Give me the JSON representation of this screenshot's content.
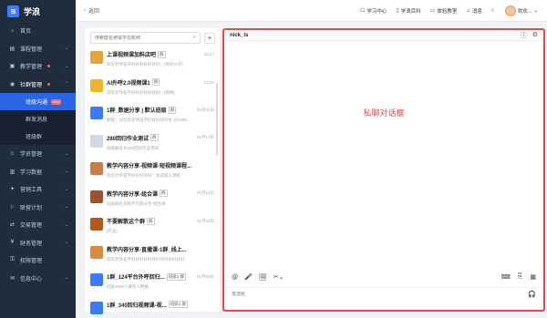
{
  "app": {
    "logo_mark": "≋",
    "name": "学浪"
  },
  "sidebar": {
    "items": [
      {
        "label": "首页",
        "icon": "⌂"
      },
      {
        "label": "课程管理",
        "icon": "▤",
        "arrow": "⌄"
      },
      {
        "label": "教学管理",
        "icon": "▣",
        "arrow": "⌄",
        "dot": true
      },
      {
        "label": "社群管理",
        "icon": "◉",
        "arrow": "⌃",
        "dot": true,
        "open": true
      }
    ],
    "sub_items": [
      {
        "label": "班级沟通",
        "badge": "new",
        "active": true
      },
      {
        "label": "群发消息"
      },
      {
        "label": "班级群"
      }
    ],
    "items_after": [
      {
        "label": "学员管理",
        "icon": "☺",
        "arrow": "⌄"
      },
      {
        "label": "学习数据",
        "icon": "▥",
        "arrow": "⌄"
      },
      {
        "label": "营销工具",
        "icon": "✦",
        "arrow": "⌄"
      },
      {
        "label": "联营计划",
        "icon": "⚐",
        "arrow": "⌄"
      },
      {
        "label": "交易管理",
        "icon": "⇄",
        "arrow": "⌄"
      },
      {
        "label": "财务管理",
        "icon": "¥",
        "arrow": "⌄"
      },
      {
        "label": "权限管理",
        "icon": "⚿"
      },
      {
        "label": "信息中心",
        "icon": "✉",
        "arrow": "⌄"
      }
    ]
  },
  "header": {
    "back_icon": "‹",
    "back_label": "返回",
    "links": [
      {
        "icon": "☖",
        "label": "学习中心"
      },
      {
        "icon": "▯",
        "label": "学浪百科"
      },
      {
        "icon": "▭",
        "label": "体验教室"
      },
      {
        "icon": "♫",
        "label": "消息"
      }
    ],
    "theme_icon": "☾",
    "username": "欢欢...",
    "user_arrow": "⌄"
  },
  "list": {
    "search_placeholder": "搜索群名称或学员昵称",
    "search_icon": "⌕",
    "add_icon": "+",
    "conversations": [
      {
        "title": "上课视频课加料店吧",
        "tag": "群",
        "time": "16:17",
        "preview": "欢欢老师名字好好好好好好好：[体验分享]",
        "color": "#e8a33a"
      },
      {
        "title": "AI外呼2.0视频课1",
        "tag": "群",
        "time": "14:20",
        "preview": "欢欢老师名字好好好好好好好：[视频]",
        "color": "#f0b429"
      },
      {
        "title": "1群_数据分享 | 默认班级",
        "tag": "群",
        "time": "01月30日",
        "preview": "群管：@欢欢老师名字好好好好好好 @4589...",
        "color": "#3b7bff"
      },
      {
        "title": "280回归作业测试",
        "tag": "群",
        "time": "01月17日",
        "preview": "班级群名为280回归作业测试",
        "color": "#cfd8e3"
      },
      {
        "title": "教学内容分享-视频课-短视频课程...",
        "tag": "",
        "time": "",
        "preview": "欢欢老师名字好好好好好：欢迎加入课程",
        "color": "#c97b4a"
      },
      {
        "title": "教学内容分享-组合课",
        "tag": "群",
        "time": "01月16日",
        "preview": "班级群名为教学内容分享-组合课",
        "color": "#a0522d"
      },
      {
        "title": "不要解散这个群",
        "tag": "群",
        "time": "01月10日",
        "preview": "[作业]",
        "color": "#b8561f"
      },
      {
        "title": "教学内容分享-直播课-1群_线上...",
        "tag": "",
        "time": "",
        "preview": "欢欢老师名字好好好好好好好好好好好好好",
        "color": "#d98c3a"
      },
      {
        "title": "1群_124平台外呼回归...",
        "tag": "班级2 群",
        "time": "01月09日",
        "preview": "班级4589人群新人数据",
        "color": "#3b7bff"
      },
      {
        "title": "1群_340回归视频课-视...",
        "tag": "班级2 群",
        "time": "",
        "preview": "",
        "color": "#3b7bff"
      }
    ]
  },
  "chat": {
    "name": "nick_ls",
    "info_icon": "ⓘ",
    "settings_icon": "⚙",
    "label": "私聊对话框",
    "tools": [
      "@",
      "🎤",
      "🖼",
      "✂⌄"
    ],
    "tools_right": [
      "⌨",
      "⎘",
      "▦"
    ],
    "input_placeholder": "发送给",
    "send_icon": "🎧"
  }
}
